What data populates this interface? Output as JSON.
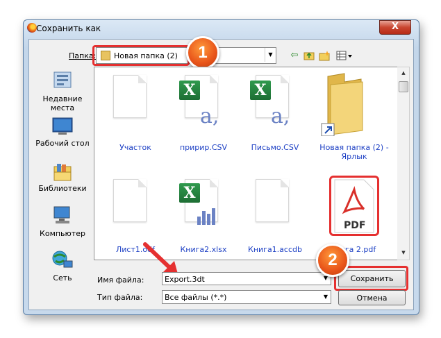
{
  "window": {
    "title": "Сохранить как",
    "close_label": "X"
  },
  "toolbar": {
    "folder_label": "Папка:",
    "folder_value": "Новая папка (2)",
    "icons": [
      "back-icon",
      "up-folder-icon",
      "new-folder-icon",
      "view-menu-icon"
    ]
  },
  "places": [
    {
      "label": "Недавние места",
      "line1": "Недавние",
      "line2": "места",
      "icon": "recent-places-icon"
    },
    {
      "label": "Рабочий стол",
      "icon": "desktop-icon"
    },
    {
      "label": "Библиотеки",
      "icon": "libraries-icon"
    },
    {
      "label": "Компьютер",
      "icon": "computer-icon"
    },
    {
      "label": "Сеть",
      "icon": "network-icon"
    }
  ],
  "files": [
    {
      "name": "Участок",
      "type": "blank-file-icon"
    },
    {
      "name": "пририр.CSV",
      "type": "excel-csv-icon"
    },
    {
      "name": "Письмо.CSV",
      "type": "excel-csv-icon"
    },
    {
      "name": "Новая папка (2) - Ярлык",
      "line1": "Новая папка (2) -",
      "line2": "Ярлык",
      "type": "folder-shortcut-icon"
    },
    {
      "name": "Лист1.odf",
      "type": "blank-file-icon"
    },
    {
      "name": "Книга2.xlsx",
      "type": "excel-xlsx-icon"
    },
    {
      "name": "Книга1.accdb",
      "type": "blank-file-icon"
    },
    {
      "name": "Книга 2.pdf",
      "type": "pdf-file-icon"
    }
  ],
  "pdf_label": "PDF",
  "bottom": {
    "filename_label": "Имя файла:",
    "filename_value": "Export.3dt",
    "filetype_label": "Тип файла:",
    "filetype_value": "Все файлы (*.*)",
    "save_label": "Сохранить",
    "cancel_label": "Отмена"
  },
  "annotations": {
    "badge1": "1",
    "badge2": "2"
  },
  "colors": {
    "highlight": "#e53030",
    "badge": "#e8541a",
    "link_text": "#1c3fc4"
  }
}
